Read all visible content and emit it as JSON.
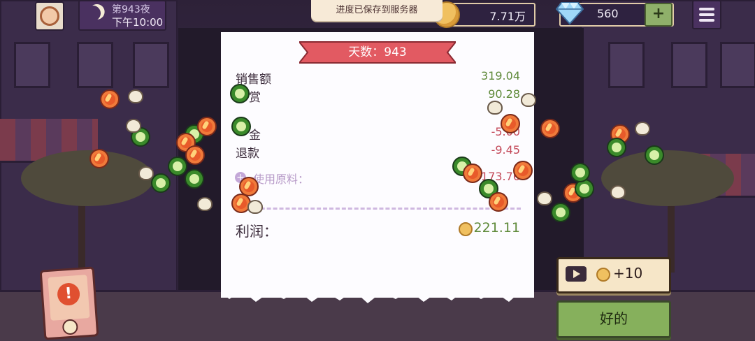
{
  "hud": {
    "night_label": "第943夜",
    "time_label": "下午10:00",
    "coins": "7.71万",
    "gems": "560",
    "plus_label": "+"
  },
  "toast": {
    "message": "进度已保存到服务器"
  },
  "receipt": {
    "day_title": "天数：943",
    "rows": [
      {
        "label": "销售额",
        "value": "319.04",
        "kind": "pos"
      },
      {
        "label": "赏",
        "value": "90.28",
        "kind": "pos"
      },
      {
        "label": "金",
        "value": "-5.00",
        "kind": "neg"
      },
      {
        "label": "退款",
        "value": "-9.45",
        "kind": "neg"
      }
    ],
    "ingredients_label": "使用原料：",
    "ingredients_value": "173.76",
    "expand_label": "+",
    "profit_label": "利润：",
    "profit_value": "221.11"
  },
  "actions": {
    "ad_reward": "+10",
    "ok_label": "好的",
    "alert_label": "!"
  },
  "colors": {
    "positive": "#5f8a3a",
    "negative": "#c44a5a",
    "banner": "#e25a62",
    "ok_button": "#86b05c"
  }
}
